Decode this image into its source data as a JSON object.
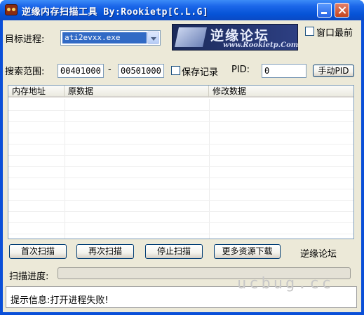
{
  "window": {
    "title": "逆缘内存扫描工具 By:Rookietp[C.L.G]"
  },
  "target": {
    "label": "目标进程:",
    "selected": "ati2evxx.exe"
  },
  "banner": {
    "name": "逆缘论坛",
    "url": "www.Rookietp.Com"
  },
  "topmost": {
    "label": "窗口最前",
    "checked": false
  },
  "range": {
    "label": "搜索范围:",
    "from": "00401000",
    "separator": "-",
    "to": "00501000"
  },
  "save_record": {
    "label": "保存记录",
    "checked": false
  },
  "pid": {
    "label": "PID:",
    "value": "0"
  },
  "manual_pid_button": "手动PID",
  "table": {
    "columns": [
      "内存地址",
      "原数据",
      "修改数据"
    ],
    "rows": []
  },
  "buttons": {
    "first_scan": "首次扫描",
    "next_scan": "再次扫描",
    "stop_scan": "停止扫描",
    "more_downloads": "更多资源下载"
  },
  "forum_link": "逆缘论坛",
  "progress": {
    "label": "扫描进度:",
    "value": 0
  },
  "status": {
    "message": "提示信息:打开进程失败!"
  },
  "watermark": "ucbug.cc"
}
